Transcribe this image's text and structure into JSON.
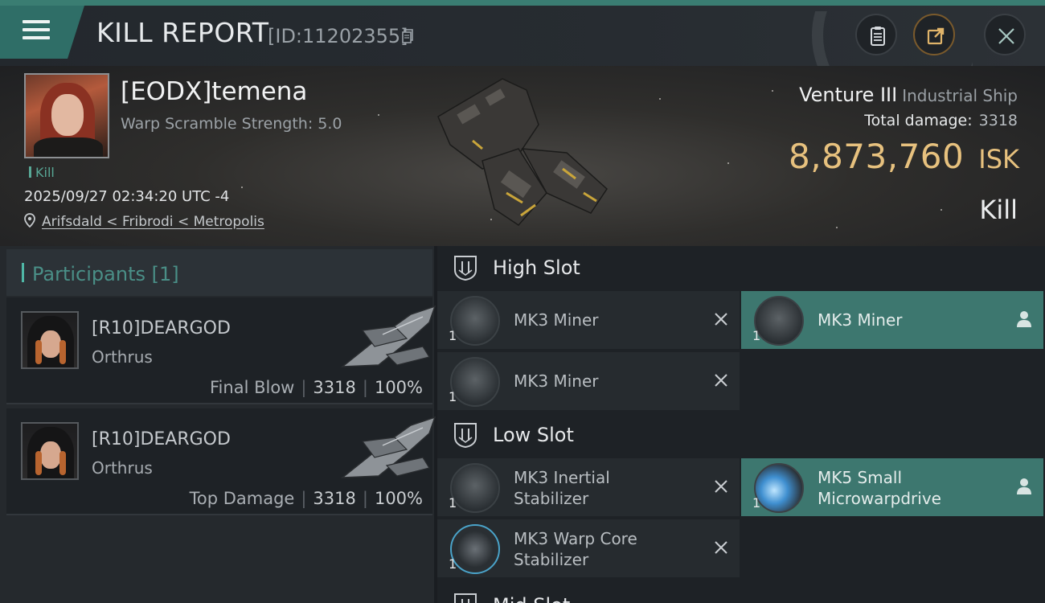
{
  "header": {
    "title": "KILL REPORT",
    "id_text": "[ID:11202355]"
  },
  "victim": {
    "name": "[EODX]temena",
    "warp_scramble": "Warp Scramble Strength: 5.0",
    "tag": "Kill",
    "timestamp": "2025/09/27 02:34:20 UTC -4",
    "location": "Arifsdald < Fribrodi < Metropolis",
    "ship_name": "Venture III",
    "ship_class": "Industrial Ship",
    "total_damage_label": "Total damage:",
    "total_damage_value": "3318",
    "isk_value": "8,873,760",
    "isk_unit": "ISK",
    "outcome": "Kill"
  },
  "participants": {
    "title": "Participants [1]",
    "rows": [
      {
        "name": "[R10]DEARGOD",
        "ship": "Orthrus",
        "label": "Final Blow",
        "damage": "3318",
        "percent": "100%"
      },
      {
        "name": "[R10]DEARGOD",
        "ship": "Orthrus",
        "label": "Top Damage",
        "damage": "3318",
        "percent": "100%"
      }
    ]
  },
  "fitting": {
    "high_slot": {
      "title": "High Slot",
      "modules": [
        {
          "name": "MK3 Miner",
          "qty": "1",
          "state": "destroyed"
        },
        {
          "name": "MK3 Miner",
          "qty": "1",
          "state": "dropped"
        },
        {
          "name": "MK3 Miner",
          "qty": "1",
          "state": "destroyed"
        }
      ]
    },
    "low_slot": {
      "title": "Low Slot",
      "modules": [
        {
          "name_line1": "MK3 Inertial",
          "name_line2": "Stabilizer",
          "qty": "1",
          "state": "destroyed"
        },
        {
          "name_line1": "MK5 Small",
          "name_line2": "Microwarpdrive",
          "qty": "1",
          "state": "dropped"
        },
        {
          "name_line1": "MK3 Warp Core",
          "name_line2": "Stabilizer",
          "qty": "1",
          "state": "destroyed"
        }
      ]
    },
    "mid_slot": {
      "title": "Mid Slot"
    }
  },
  "icons": {
    "menu": "hamburger-menu-icon",
    "copy": "copy-icon",
    "clipboard": "clipboard-icon",
    "share": "share-icon",
    "close": "close-icon",
    "location": "location-pin-icon",
    "destroyed": "x-icon",
    "dropped": "user-icon"
  },
  "colors": {
    "accent_teal": "#3d776f",
    "isk_gold": "#e7c17e",
    "kill_green": "#58a896"
  }
}
